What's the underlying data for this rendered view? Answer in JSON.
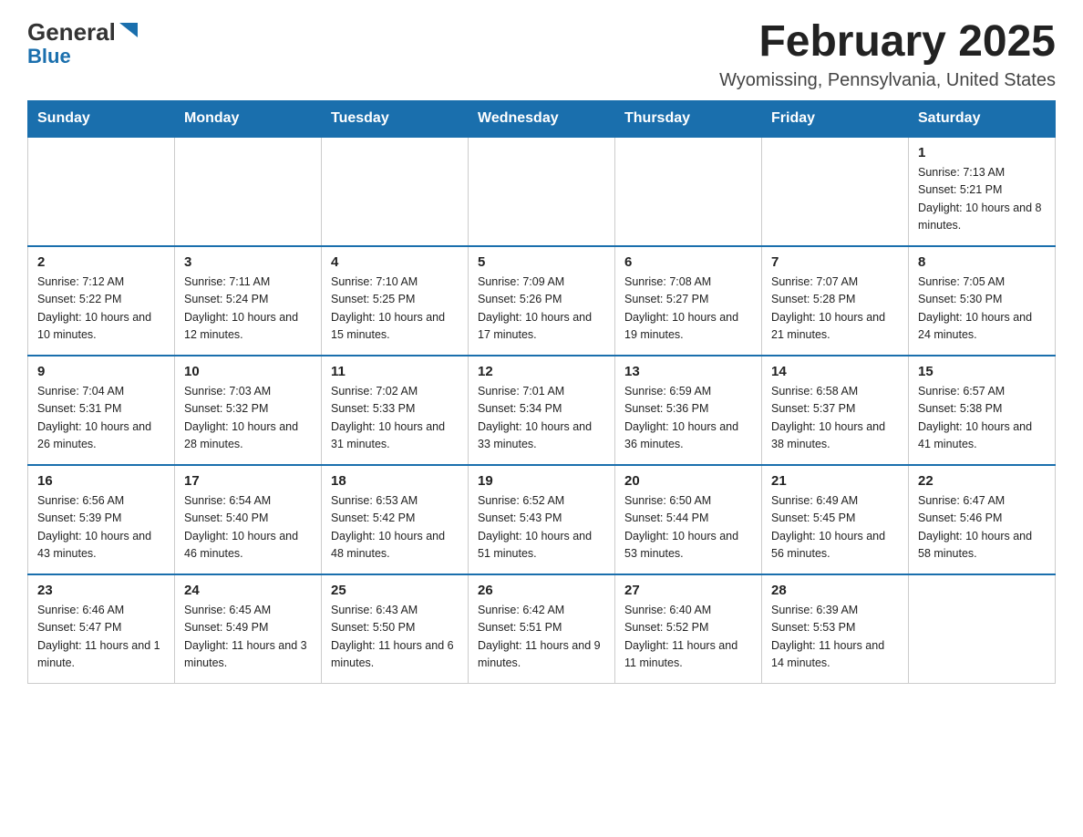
{
  "logo": {
    "general": "General",
    "blue": "Blue"
  },
  "title": "February 2025",
  "location": "Wyomissing, Pennsylvania, United States",
  "days_of_week": [
    "Sunday",
    "Monday",
    "Tuesday",
    "Wednesday",
    "Thursday",
    "Friday",
    "Saturday"
  ],
  "weeks": [
    [
      {
        "day": "",
        "info": ""
      },
      {
        "day": "",
        "info": ""
      },
      {
        "day": "",
        "info": ""
      },
      {
        "day": "",
        "info": ""
      },
      {
        "day": "",
        "info": ""
      },
      {
        "day": "",
        "info": ""
      },
      {
        "day": "1",
        "info": "Sunrise: 7:13 AM\nSunset: 5:21 PM\nDaylight: 10 hours and 8 minutes."
      }
    ],
    [
      {
        "day": "2",
        "info": "Sunrise: 7:12 AM\nSunset: 5:22 PM\nDaylight: 10 hours and 10 minutes."
      },
      {
        "day": "3",
        "info": "Sunrise: 7:11 AM\nSunset: 5:24 PM\nDaylight: 10 hours and 12 minutes."
      },
      {
        "day": "4",
        "info": "Sunrise: 7:10 AM\nSunset: 5:25 PM\nDaylight: 10 hours and 15 minutes."
      },
      {
        "day": "5",
        "info": "Sunrise: 7:09 AM\nSunset: 5:26 PM\nDaylight: 10 hours and 17 minutes."
      },
      {
        "day": "6",
        "info": "Sunrise: 7:08 AM\nSunset: 5:27 PM\nDaylight: 10 hours and 19 minutes."
      },
      {
        "day": "7",
        "info": "Sunrise: 7:07 AM\nSunset: 5:28 PM\nDaylight: 10 hours and 21 minutes."
      },
      {
        "day": "8",
        "info": "Sunrise: 7:05 AM\nSunset: 5:30 PM\nDaylight: 10 hours and 24 minutes."
      }
    ],
    [
      {
        "day": "9",
        "info": "Sunrise: 7:04 AM\nSunset: 5:31 PM\nDaylight: 10 hours and 26 minutes."
      },
      {
        "day": "10",
        "info": "Sunrise: 7:03 AM\nSunset: 5:32 PM\nDaylight: 10 hours and 28 minutes."
      },
      {
        "day": "11",
        "info": "Sunrise: 7:02 AM\nSunset: 5:33 PM\nDaylight: 10 hours and 31 minutes."
      },
      {
        "day": "12",
        "info": "Sunrise: 7:01 AM\nSunset: 5:34 PM\nDaylight: 10 hours and 33 minutes."
      },
      {
        "day": "13",
        "info": "Sunrise: 6:59 AM\nSunset: 5:36 PM\nDaylight: 10 hours and 36 minutes."
      },
      {
        "day": "14",
        "info": "Sunrise: 6:58 AM\nSunset: 5:37 PM\nDaylight: 10 hours and 38 minutes."
      },
      {
        "day": "15",
        "info": "Sunrise: 6:57 AM\nSunset: 5:38 PM\nDaylight: 10 hours and 41 minutes."
      }
    ],
    [
      {
        "day": "16",
        "info": "Sunrise: 6:56 AM\nSunset: 5:39 PM\nDaylight: 10 hours and 43 minutes."
      },
      {
        "day": "17",
        "info": "Sunrise: 6:54 AM\nSunset: 5:40 PM\nDaylight: 10 hours and 46 minutes."
      },
      {
        "day": "18",
        "info": "Sunrise: 6:53 AM\nSunset: 5:42 PM\nDaylight: 10 hours and 48 minutes."
      },
      {
        "day": "19",
        "info": "Sunrise: 6:52 AM\nSunset: 5:43 PM\nDaylight: 10 hours and 51 minutes."
      },
      {
        "day": "20",
        "info": "Sunrise: 6:50 AM\nSunset: 5:44 PM\nDaylight: 10 hours and 53 minutes."
      },
      {
        "day": "21",
        "info": "Sunrise: 6:49 AM\nSunset: 5:45 PM\nDaylight: 10 hours and 56 minutes."
      },
      {
        "day": "22",
        "info": "Sunrise: 6:47 AM\nSunset: 5:46 PM\nDaylight: 10 hours and 58 minutes."
      }
    ],
    [
      {
        "day": "23",
        "info": "Sunrise: 6:46 AM\nSunset: 5:47 PM\nDaylight: 11 hours and 1 minute."
      },
      {
        "day": "24",
        "info": "Sunrise: 6:45 AM\nSunset: 5:49 PM\nDaylight: 11 hours and 3 minutes."
      },
      {
        "day": "25",
        "info": "Sunrise: 6:43 AM\nSunset: 5:50 PM\nDaylight: 11 hours and 6 minutes."
      },
      {
        "day": "26",
        "info": "Sunrise: 6:42 AM\nSunset: 5:51 PM\nDaylight: 11 hours and 9 minutes."
      },
      {
        "day": "27",
        "info": "Sunrise: 6:40 AM\nSunset: 5:52 PM\nDaylight: 11 hours and 11 minutes."
      },
      {
        "day": "28",
        "info": "Sunrise: 6:39 AM\nSunset: 5:53 PM\nDaylight: 11 hours and 14 minutes."
      },
      {
        "day": "",
        "info": ""
      }
    ]
  ]
}
